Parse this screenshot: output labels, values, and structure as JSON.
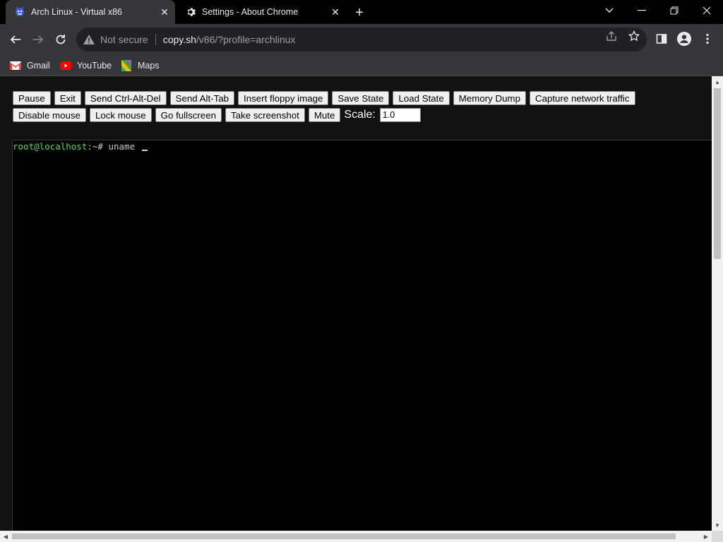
{
  "tabs": [
    {
      "title": "Arch Linux - Virtual x86",
      "icon": "v86-favicon-icon",
      "active": true
    },
    {
      "title": "Settings - About Chrome",
      "icon": "gear-icon",
      "active": false
    }
  ],
  "omnibox": {
    "security_text": "Not secure",
    "host": "copy.sh",
    "path": "/v86/?profile=archlinux"
  },
  "bookmarks": [
    {
      "label": "Gmail",
      "icon": "gmail-icon"
    },
    {
      "label": "YouTube",
      "icon": "youtube-icon"
    },
    {
      "label": "Maps",
      "icon": "maps-icon"
    }
  ],
  "controls": {
    "row1": [
      "Pause",
      "Exit",
      "Send Ctrl-Alt-Del",
      "Send Alt-Tab",
      "Insert floppy image",
      "Save State",
      "Load State",
      "Memory Dump",
      "Capture network traffic"
    ],
    "row2": [
      "Disable mouse",
      "Lock mouse",
      "Go fullscreen",
      "Take screenshot",
      "Mute"
    ],
    "scale_label": "Scale:",
    "scale_value": "1.0"
  },
  "terminal": {
    "user_host": "root@localhost",
    "path": ":~",
    "prompt": "# ",
    "command": "uname"
  },
  "colors": {
    "chrome_dark": "#35363a",
    "omnibox_bg": "#202124",
    "terminal_green": "#5fd75f"
  }
}
